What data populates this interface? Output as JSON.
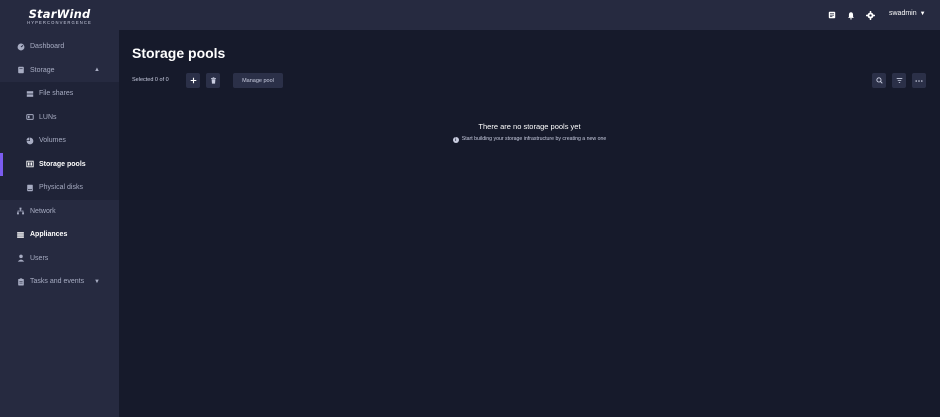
{
  "brand": {
    "name": "StarWind",
    "tagline": "HYPERCONVERGENCE"
  },
  "sidebar": {
    "items": [
      {
        "label": "Dashboard",
        "icon": "dashboard-icon"
      },
      {
        "label": "Storage",
        "icon": "storage-icon"
      },
      {
        "label": "File shares",
        "icon": "file-shares-icon"
      },
      {
        "label": "LUNs",
        "icon": "luns-icon"
      },
      {
        "label": "Volumes",
        "icon": "volumes-icon"
      },
      {
        "label": "Storage pools",
        "icon": "storage-pools-icon"
      },
      {
        "label": "Physical disks",
        "icon": "physical-disks-icon"
      },
      {
        "label": "Network",
        "icon": "network-icon"
      },
      {
        "label": "Appliances",
        "icon": "appliances-icon"
      },
      {
        "label": "Users",
        "icon": "users-icon"
      },
      {
        "label": "Tasks and events",
        "icon": "tasks-icon"
      }
    ],
    "active": "Storage pools"
  },
  "topbar": {
    "username": "swadmin"
  },
  "page": {
    "title": "Storage pools",
    "selected_text": "Selected 0 of 0",
    "manage_label": "Manage pool"
  },
  "empty_state": {
    "title": "There are no storage pools yet",
    "subtitle": "Start building your storage infrastructure by creating a new one"
  },
  "colors": {
    "accent": "#7b5cf0",
    "sidebar_bg": "#262a40",
    "main_bg": "#161a2b"
  }
}
